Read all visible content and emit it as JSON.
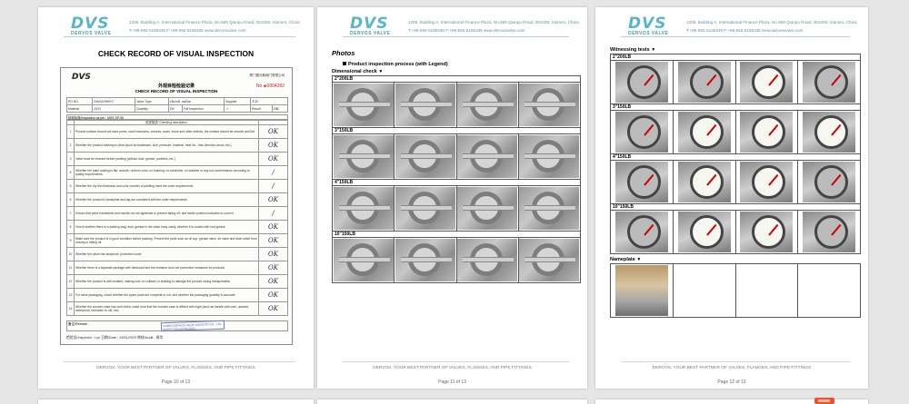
{
  "brand": {
    "logo_text": "DVS",
    "logo_sub": "DERVOS VALVE",
    "address": "1205, Building A, International Finance Plaza, No.568 Qianpu Road, 361008, Xiamen, China",
    "contact": "T:+86-592-5185336   F:+86-592-5185335   www.dervosvalve.com",
    "footer": "DERVOS, YOUR BEST PARTNER OF VALVES, FLANGES, AND PIPE FITTINGS"
  },
  "pages": [
    {
      "title": "CHECK RECORD OF VISUAL INSPECTION",
      "page_label": "Page 10 of 13",
      "form": {
        "logo": "DVS",
        "company": "厦门德沃斯阀门有限公司",
        "title_cn": "外观目检检验记录",
        "title_en": "CHECK RECORD OF VISUAL INSPECTION",
        "number": "No ◈0004282",
        "header_rows": [
          [
            "PO NO.",
            "5062098-C",
            "Valve Type",
            "check valve",
            "Supplier",
            "T.D."
          ],
          [
            "Material",
            "316",
            "Quantity",
            "16",
            "Full Inspection",
            "✓",
            "Result",
            "OK"
          ]
        ],
        "standard": "检验标准/Inspection as per : MSS SP-55",
        "checks_header": "检查描述/ Checking description",
        "checks": [
          {
            "n": "1",
            "text": "Product surface should not have pores, sand inclusions, creases, scars, loose and other defects, the surface should be smooth and flat",
            "mark": "OK"
          },
          {
            "n": "2",
            "text": "Whether the product marking is clear (such as trademark, size, pressure, material, heat No., flow direction arrow, etc.)",
            "mark": "OK"
          },
          {
            "n": "3",
            "text": "Valve must be cleaned before painting (without dust, grease, particles, etc.)",
            "mark": "OK"
          },
          {
            "n": "4",
            "text": "Whether the paint coating is flat, smooth, uniform color, no foaming, no scratches, no bubbles or any non-conformance according to quality requirements",
            "mark": "/"
          },
          {
            "n": "5",
            "text": "Whether the dry film thickness and color number of painting meet the order requirements",
            "mark": "/"
          },
          {
            "n": "6",
            "text": "Whether the product's nameplate and tag are consistent with the order requirements",
            "mark": "OK"
          },
          {
            "n": "7",
            "text": "Ensure that valve handwheel and handle nut are tightened to prevent falling off, and switch position indication is correct",
            "mark": "/"
          },
          {
            "n": "8",
            "text": "Check whether there is a welding slag, dust, grease in the valve body cavity, whether it is coated with rust grease",
            "mark": "OK"
          },
          {
            "n": "9",
            "text": "Make sure the product is in good condition before packing. Prevent the parts such as oil cup, grease valve, air valve and drain valve from loosing or falling off",
            "mark": "OK"
          },
          {
            "n": "10",
            "text": "Whether the valve has dustproof, protective cover",
            "mark": "OK"
          },
          {
            "n": "11",
            "text": "Whether there is a separate package with desiccant and the moisture and rust prevention measures for products",
            "mark": "OK"
          },
          {
            "n": "12",
            "text": "Whether the product is well isolated, making sure no collision or shaking to damage the product during transportation",
            "mark": "OK"
          },
          {
            "n": "13",
            "text": "For valve packaging, check whether the spare parts are complete or not, and whether the packaging quantity is accurate",
            "mark": "OK"
          },
          {
            "n": "14",
            "text": "Whether the wooden case has vent holes, make sure that the wooden case is affixed with eight (such as handle with care, upward, waterproof, forbidden to roll, etc)",
            "mark": "OK"
          }
        ],
        "remark": "备注/Remark :",
        "stamp": "XIAMEN DERVOS VALVE INDUSTRY CO., LTD  INSPECTION APPROVED",
        "sign_line": "检验员/Inspector : Lyn     日期/Date : 19/01/2023     审核/Audit : 周华"
      }
    },
    {
      "title": "Photos",
      "subtitle": "Product inspection process (with Legend)",
      "section": "Dimensional check",
      "dropdown_symbol": "▼",
      "page_label": "Page 11 of 13",
      "groups": [
        {
          "label": "2\"200LB",
          "photos": [
            "gauge-photo",
            "caliper-photo",
            "caliper-photo",
            "caliper-photo"
          ]
        },
        {
          "label": "3\"150LB",
          "photos": [
            "caliper-photo",
            "caliper-photo",
            "caliper-photo",
            "caliper-photo"
          ]
        },
        {
          "label": "4\"150LB",
          "photos": [
            "caliper-photo",
            "caliper-photo",
            "caliper-photo",
            "caliper-photo"
          ]
        },
        {
          "label": "10\"150LB",
          "photos": [
            "caliper-photo",
            "caliper-photo",
            "caliper-photo",
            "caliper-photo"
          ]
        }
      ]
    },
    {
      "title": "Witnessing tests",
      "dropdown_symbol": "▼",
      "page_label": "Page 12 of 13",
      "groups": [
        {
          "label": "2\"200LB",
          "photos": [
            "valve",
            "valve",
            "gauge",
            "valve"
          ]
        },
        {
          "label": "3\"150LB",
          "photos": [
            "valve",
            "gauge",
            "gauge",
            "gauge"
          ]
        },
        {
          "label": "4\"150LB",
          "photos": [
            "valve",
            "gauge",
            "gauge",
            "valve"
          ]
        },
        {
          "label": "10\"150LB",
          "photos": [
            "valve",
            "gauge",
            "gauge",
            "valve"
          ]
        }
      ],
      "nameplate": {
        "label": "Nameplate",
        "dropdown_symbol": "▼"
      }
    }
  ]
}
